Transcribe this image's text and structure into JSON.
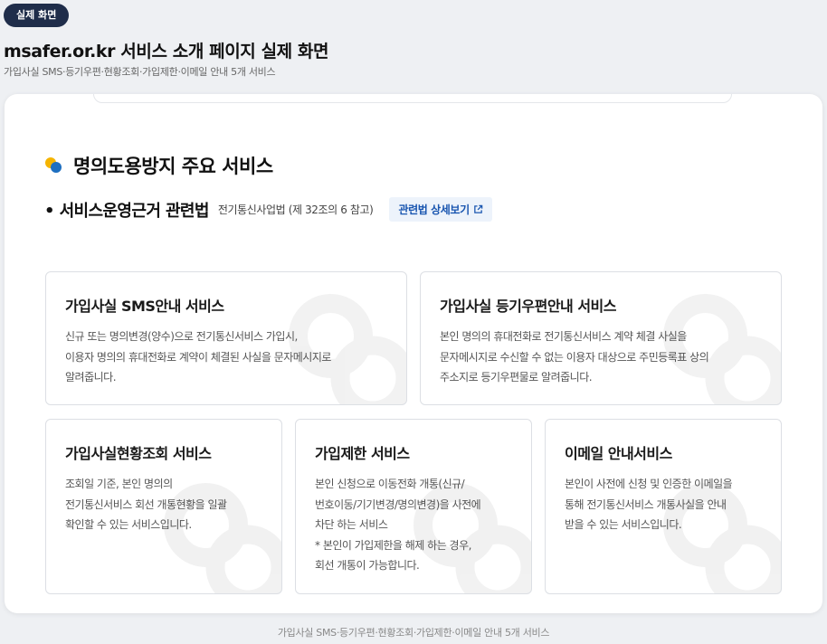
{
  "badge": "실제 화면",
  "page": {
    "title": "msafer.or.kr 서비스 소개 페이지 실제 화면",
    "subtitle": "가입사실 SMS·등기우편·현황조회·가입제한·이메일 안내 5개 서비스"
  },
  "section": {
    "title": "명의도용방지 주요 서비스",
    "basis_label": "• 서비스운영근거 관련법",
    "basis_law": "전기통신사업법 (제 32조의 6 참고)",
    "law_link": "관련법 상세보기"
  },
  "cards": [
    {
      "title": "가입사실 SMS안내 서비스",
      "lines": [
        "신규 또는 명의변경(양수)으로 전기통신서비스 가입시,",
        "이용자 명의의 휴대전화로 계약이 체결된 사실을 문자메시지로",
        "알려줍니다."
      ]
    },
    {
      "title": "가입사실 등기우편안내 서비스",
      "lines": [
        "본인 명의의 휴대전화로 전기통신서비스 계약 체결 사실을",
        "문자메시지로 수신할 수 없는 이용자 대상으로 주민등록표 상의",
        "주소지로 등기우편물로 알려줍니다."
      ]
    },
    {
      "title": "가입사실현황조회 서비스",
      "lines": [
        "조회일 기준, 본인 명의의",
        "전기통신서비스 회선 개통현황을 일괄",
        "확인할 수 있는 서비스입니다."
      ]
    },
    {
      "title": "가입제한 서비스",
      "lines": [
        "본인 신청으로 이동전화 개통(신규/",
        "번호이동/기기변경/명의변경)을 사전에",
        "차단 하는 서비스",
        "* 본인이 가입제한을 해제 하는 경우,",
        "회선 개통이 가능합니다."
      ]
    },
    {
      "title": "이메일 안내서비스",
      "lines": [
        "본인이 사전에 신청 및 인증한 이메일을",
        "통해 전기통신서비스 개통사실을 안내",
        "받을 수 있는 서비스입니다."
      ]
    }
  ],
  "footer": "가입사실 SMS·등기우편·현황조회·가입제한·이메일 안내 5개 서비스",
  "colors": {
    "badge_bg": "#1f2d4a",
    "link_text": "#1a56b0",
    "link_bg": "#edf3fb",
    "dot_yellow": "#f5b400",
    "dot_blue": "#1e6fc0"
  },
  "icons": [
    "service-logo-dots-icon",
    "external-link-icon",
    "watermark-logo-icon"
  ]
}
